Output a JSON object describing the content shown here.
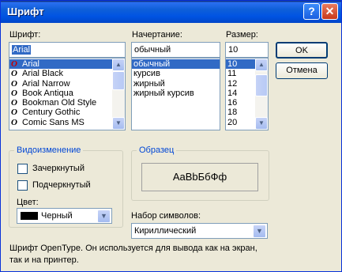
{
  "window": {
    "title": "Шрифт",
    "help_icon": "question-mark",
    "close_icon": "x"
  },
  "font": {
    "label": "Шрифт:",
    "value": "Arial",
    "items": [
      {
        "glyph": "O",
        "name": "Arial",
        "selected": true
      },
      {
        "glyph": "O",
        "name": "Arial Black"
      },
      {
        "glyph": "O",
        "name": "Arial Narrow"
      },
      {
        "glyph": "O",
        "name": "Book Antiqua"
      },
      {
        "glyph": "O",
        "name": "Bookman Old Style"
      },
      {
        "glyph": "O",
        "name": "Century Gothic"
      },
      {
        "glyph": "O",
        "name": "Comic Sans MS"
      }
    ]
  },
  "style": {
    "label": "Начертание:",
    "value": "обычный",
    "items": [
      "обычный",
      "курсив",
      "жирный",
      "жирный курсив"
    ],
    "selected_index": 0
  },
  "size": {
    "label": "Размер:",
    "value": "10",
    "items": [
      "10",
      "11",
      "12",
      "14",
      "16",
      "18",
      "20"
    ],
    "selected_index": 0
  },
  "buttons": {
    "ok": "OK",
    "cancel": "Отмена"
  },
  "effects": {
    "title": "Видоизменение",
    "strikeout": "Зачеркнутый",
    "underline": "Подчеркнутый",
    "strikeout_checked": false,
    "underline_checked": false,
    "color_label": "Цвет:",
    "color_value": "Черный",
    "color_swatch": "#000000"
  },
  "sample": {
    "title": "Образец",
    "text": "AaBbБбФф"
  },
  "charset": {
    "label": "Набор символов:",
    "value": "Кириллический"
  },
  "description": "Шрифт OpenType. Он используется для вывода как на экран, так и на принтер."
}
